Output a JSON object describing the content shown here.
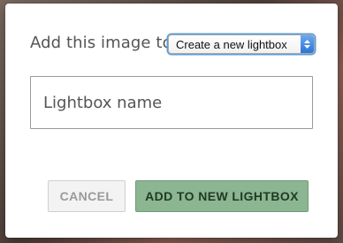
{
  "dialog": {
    "add_label": "Add this image to",
    "select": {
      "selected": "Create a new lightbox"
    },
    "name_input": {
      "placeholder": "Lightbox name",
      "value": ""
    },
    "buttons": {
      "cancel": "CANCEL",
      "submit": "ADD TO NEW LIGHTBOX"
    }
  },
  "colors": {
    "submit_button": "#8cb592",
    "focus_ring": "#5b9dd9"
  }
}
